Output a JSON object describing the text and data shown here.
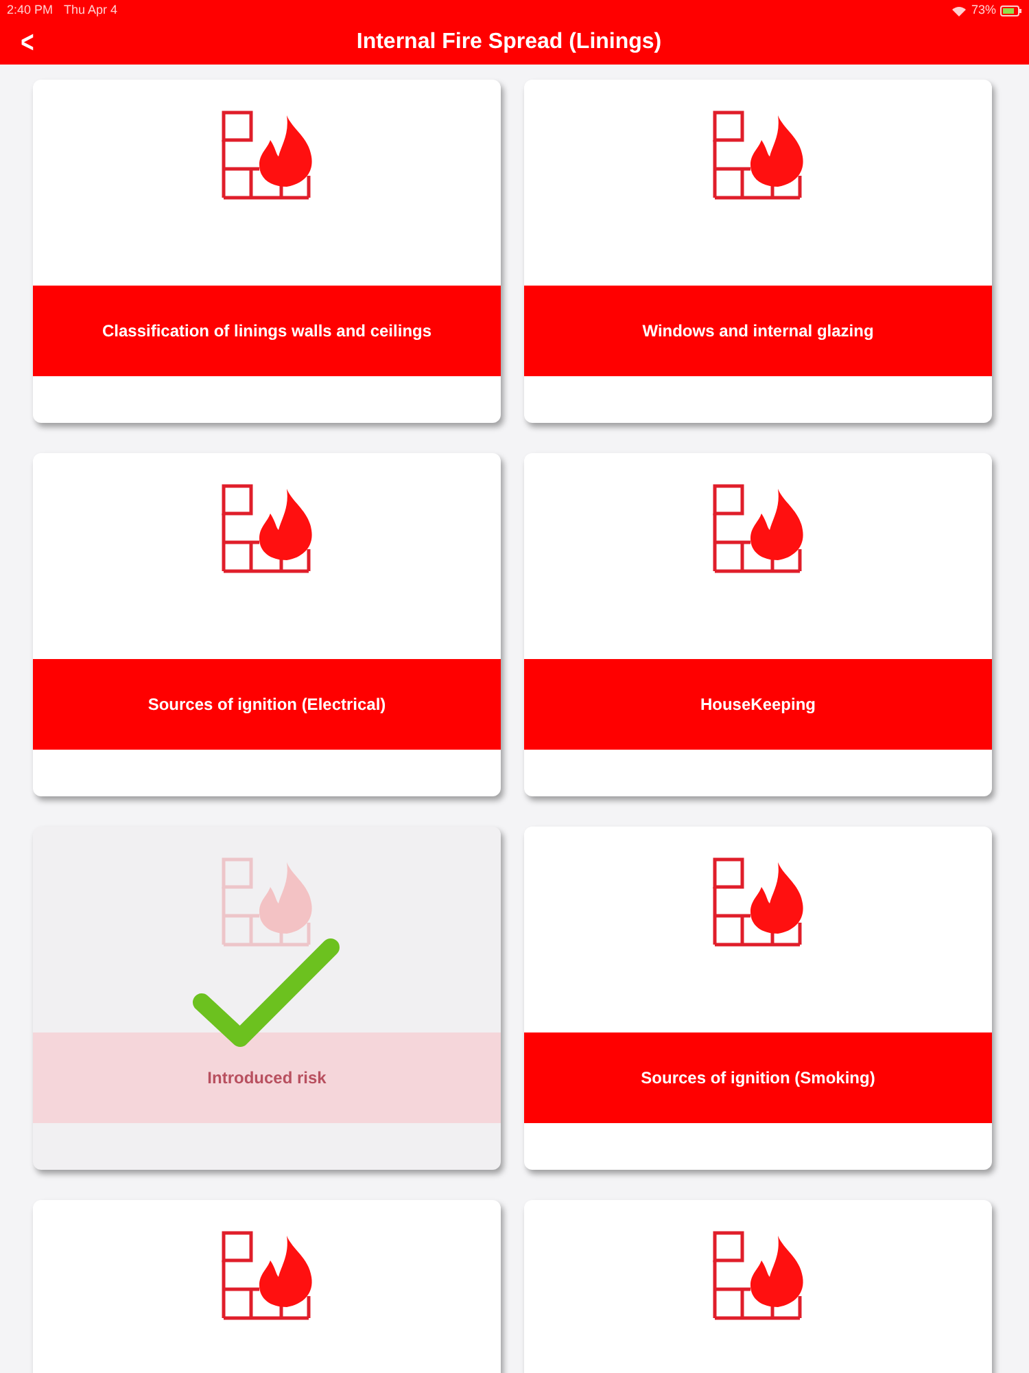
{
  "status_bar": {
    "time": "2:40 PM",
    "date": "Thu Apr 4",
    "battery": "73%"
  },
  "nav": {
    "back": "<",
    "title": "Internal Fire Spread (Linings)"
  },
  "cards": [
    {
      "label": "Classification of linings walls and ceilings",
      "completed": false
    },
    {
      "label": "Windows and internal glazing",
      "completed": false
    },
    {
      "label": "Sources of ignition (Electrical)",
      "completed": false
    },
    {
      "label": "HouseKeeping",
      "completed": false
    },
    {
      "label": "Introduced risk",
      "completed": true
    },
    {
      "label": "Sources of ignition (Smoking)",
      "completed": false
    },
    {
      "completed": false
    },
    {
      "completed": false
    }
  ]
}
